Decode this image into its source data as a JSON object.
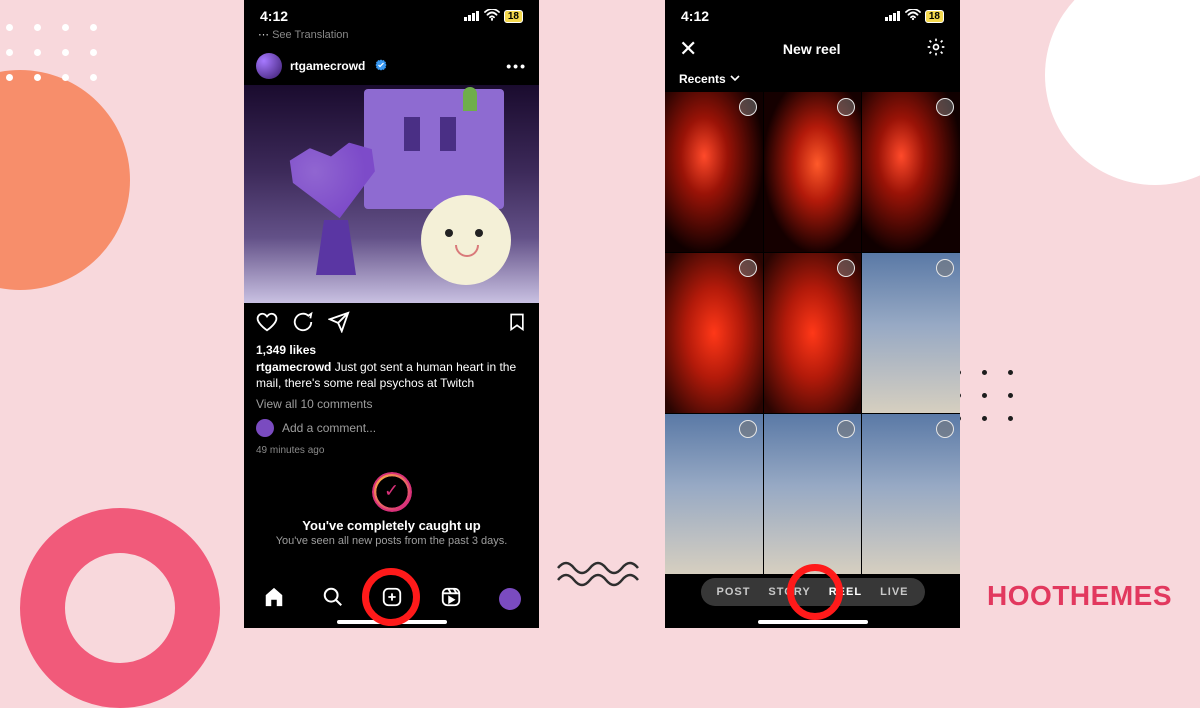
{
  "status": {
    "time": "4:12",
    "battery": "18"
  },
  "feed": {
    "truncated_hint": "See Translation",
    "username": "rtgamecrowd",
    "more": "•••",
    "likes": "1,349 likes",
    "caption_user": "rtgamecrowd",
    "caption_text": " Just got sent a human heart in the mail, there's some real psychos at Twitch",
    "view_comments": "View all 10 comments",
    "add_comment": "Add a comment...",
    "age": "49 minutes ago",
    "caught_title": "You've completely caught up",
    "caught_sub": "You've seen all new posts from the past 3 days."
  },
  "reel": {
    "title": "New reel",
    "recents": "Recents",
    "modes": {
      "post": "POST",
      "story": "STORY",
      "reel": "REEL",
      "live": "LIVE"
    }
  },
  "brand": "OOTHEMES"
}
